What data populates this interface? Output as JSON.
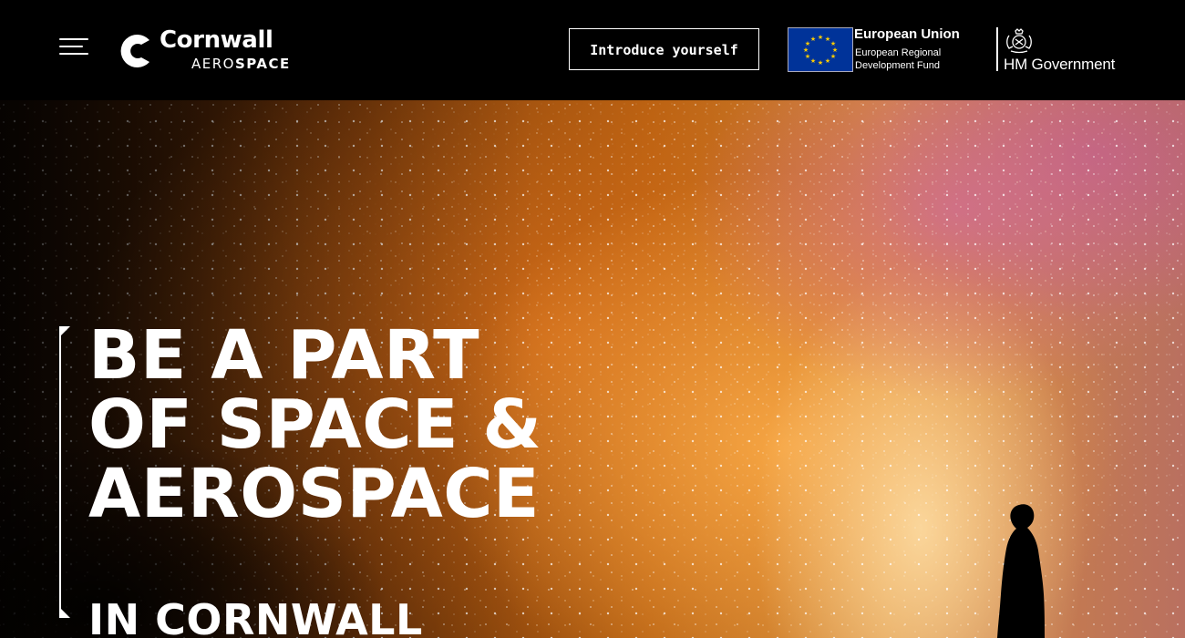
{
  "header": {
    "logo": {
      "line1": "Cornwall",
      "line2_light": "AERO",
      "line2_bold": "SPACE"
    },
    "intro_button": "Introduce yourself",
    "eu": {
      "title": "European Union",
      "subtitle_line1": "European Regional",
      "subtitle_line2": "Development Fund"
    },
    "hmg": {
      "label": "HM Government"
    }
  },
  "hero": {
    "headline": [
      "BE A PART",
      "OF SPACE &",
      "AEROSPACE"
    ],
    "subheadline": "IN CORNWALL"
  },
  "colors": {
    "header_bg": "#000000",
    "text": "#ffffff",
    "eu_blue": "#003399",
    "eu_star": "#ffcc00"
  }
}
